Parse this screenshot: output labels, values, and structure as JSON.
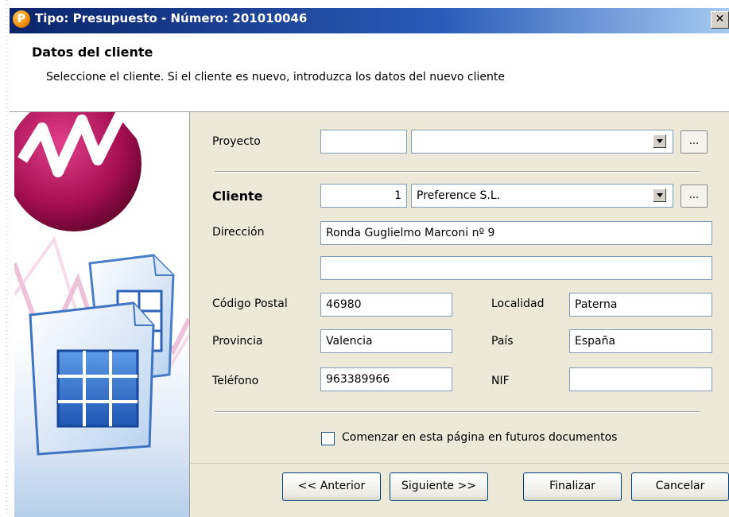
{
  "window": {
    "title": "Tipo: Presupuesto - Número: 201010046",
    "app_icon_glyph": "P",
    "close_glyph": "✕"
  },
  "header": {
    "title": "Datos del cliente",
    "subtitle": "Seleccione el cliente. Si el cliente es nuevo, introduzca los datos del nuevo cliente"
  },
  "form": {
    "proyecto": {
      "label": "Proyecto",
      "code": "",
      "name": "",
      "browse": "..."
    },
    "cliente": {
      "label": "Cliente",
      "code": "1",
      "name": "Preference S.L.",
      "browse": "..."
    },
    "direccion": {
      "label": "Dirección",
      "line1": "Ronda Guglielmo Marconi nº 9",
      "line2": ""
    },
    "codigo_postal": {
      "label": "Código Postal",
      "value": "46980"
    },
    "localidad": {
      "label": "Localidad",
      "value": "Paterna"
    },
    "provincia": {
      "label": "Provincia",
      "value": "Valencia"
    },
    "pais": {
      "label": "País",
      "value": "España"
    },
    "telefono": {
      "label": "Teléfono",
      "value": "963389966"
    },
    "nif": {
      "label": "NIF",
      "value": ""
    },
    "start_checkbox": {
      "label": "Comenzar en esta página en futuros documentos",
      "checked": false
    }
  },
  "buttons": {
    "back": "<< Anterior",
    "next": "Siguiente >>",
    "finish": "Finalizar",
    "cancel": "Cancelar"
  },
  "icons": [
    "app-logo-icon",
    "close-icon",
    "dropdown-arrow-icon",
    "documents-illustration-icon"
  ],
  "colors": {
    "titlebar": "#0a246a",
    "panel": "#ece9d8",
    "accent_magenta": "#b0105a"
  }
}
